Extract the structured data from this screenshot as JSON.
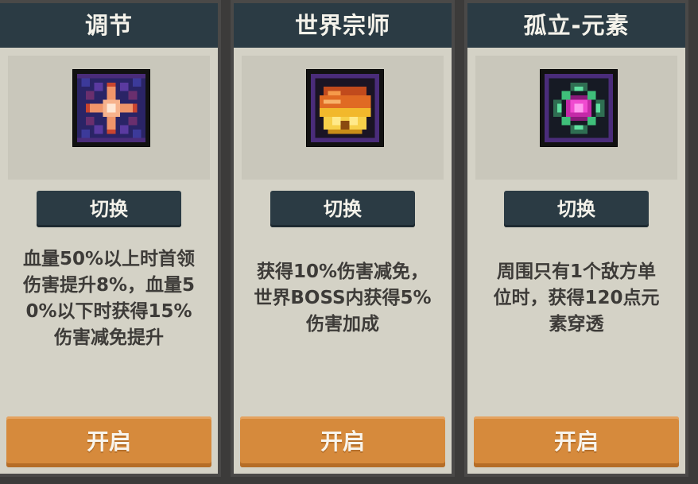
{
  "cards": [
    {
      "title": "调节",
      "icon": "cross-sparkle-icon",
      "switch_label": "切换",
      "description": "血量50%以上时首领\n伤害提升8%，血量5\n0%以下时获得15%\n伤害减免提升",
      "activate_label": "开启"
    },
    {
      "title": "世界宗师",
      "icon": "golden-helmet-icon",
      "switch_label": "切换",
      "description": "获得10%伤害减免，\n世界BOSS内获得5%\n伤害加成",
      "activate_label": "开启"
    },
    {
      "title": "孤立-元素",
      "icon": "element-gem-icon",
      "switch_label": "切换",
      "description": "周围只有1个敌方单\n位时，获得120点元\n素穿透",
      "activate_label": "开启"
    }
  ],
  "colors": {
    "header_bg": "#2b3b44",
    "card_bg": "#d4d2c6",
    "activate_button": "#d68a3c",
    "text_dark": "#3d3b38",
    "text_light": "#f4f2ea"
  }
}
